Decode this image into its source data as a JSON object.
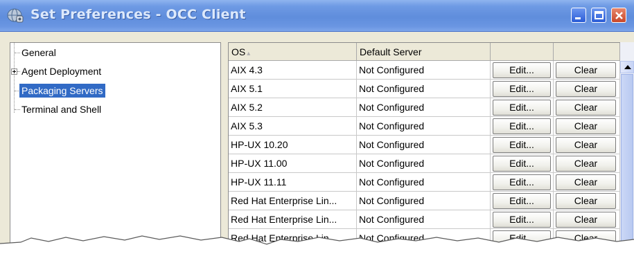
{
  "window": {
    "title": "Set Preferences - OCC Client",
    "app_icon": "settings-globe-icon"
  },
  "tree": {
    "items": [
      {
        "label": "General",
        "selected": false,
        "expandable": false
      },
      {
        "label": "Agent Deployment",
        "selected": false,
        "expandable": true
      },
      {
        "label": "Packaging Servers",
        "selected": true,
        "expandable": false
      },
      {
        "label": "Terminal and Shell",
        "selected": false,
        "expandable": false
      }
    ]
  },
  "table": {
    "columns": [
      "OS",
      "Default Server",
      "",
      ""
    ],
    "sort_icon": "sort-indicator-icon",
    "edit_label": "Edit...",
    "clear_label": "Clear",
    "rows": [
      {
        "os": "AIX 4.3",
        "server": "Not Configured"
      },
      {
        "os": "AIX 5.1",
        "server": "Not Configured"
      },
      {
        "os": "AIX 5.2",
        "server": "Not Configured"
      },
      {
        "os": "AIX 5.3",
        "server": "Not Configured"
      },
      {
        "os": "HP-UX 10.20",
        "server": "Not Configured"
      },
      {
        "os": "HP-UX 11.00",
        "server": "Not Configured"
      },
      {
        "os": "HP-UX 11.11",
        "server": "Not Configured"
      },
      {
        "os": "Red Hat Enterprise Lin...",
        "server": "Not Configured"
      },
      {
        "os": "Red Hat Enterprise Lin...",
        "server": "Not Configured"
      },
      {
        "os": "Red Hat Enterprise Lin...",
        "server": "Not Configured"
      }
    ]
  },
  "colors": {
    "titlebar": "#6e9ae4",
    "selection": "#316ac5",
    "close_button": "#c7472a"
  }
}
